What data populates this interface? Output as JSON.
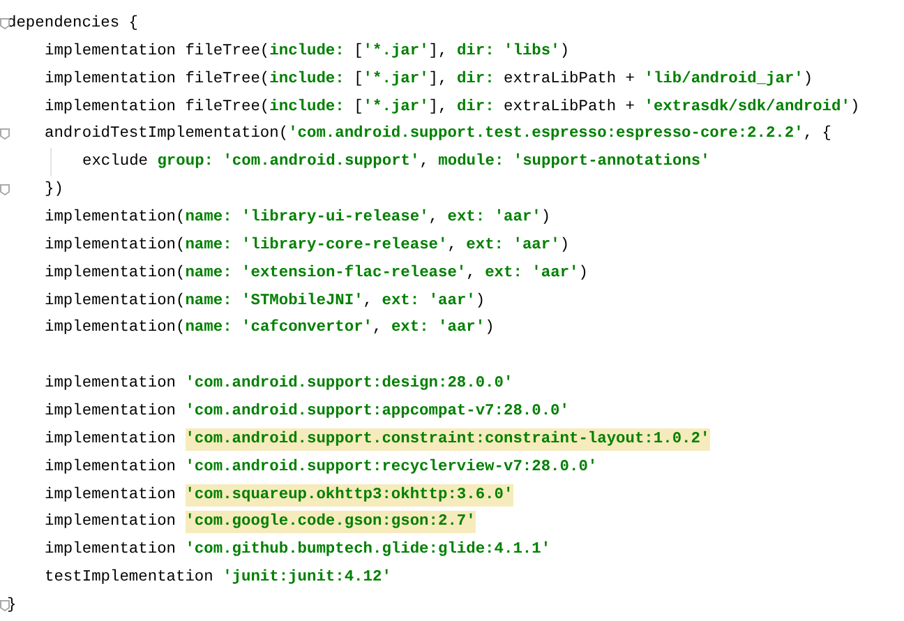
{
  "lines": [
    {
      "kind": "code",
      "fold": true,
      "segments": [
        {
          "kind": "plain",
          "text": "dependencies {"
        }
      ],
      "children": [
        {
          "kind": "code",
          "fold": false,
          "segments": [
            {
              "kind": "plain",
              "text": "implementation fileTree("
            },
            {
              "kind": "param",
              "text": "include: "
            },
            {
              "kind": "plain",
              "text": "["
            },
            {
              "kind": "string",
              "text": "'*.jar'"
            },
            {
              "kind": "plain",
              "text": "], "
            },
            {
              "kind": "param",
              "text": "dir: "
            },
            {
              "kind": "string",
              "text": "'libs'"
            },
            {
              "kind": "plain",
              "text": ")"
            }
          ]
        },
        {
          "kind": "code",
          "fold": false,
          "segments": [
            {
              "kind": "plain",
              "text": "implementation fileTree("
            },
            {
              "kind": "param",
              "text": "include: "
            },
            {
              "kind": "plain",
              "text": "["
            },
            {
              "kind": "string",
              "text": "'*.jar'"
            },
            {
              "kind": "plain",
              "text": "], "
            },
            {
              "kind": "param",
              "text": "dir: "
            },
            {
              "kind": "plain",
              "text": "extraLibPath + "
            },
            {
              "kind": "string",
              "text": "'lib/android_jar'"
            },
            {
              "kind": "plain",
              "text": ")"
            }
          ]
        },
        {
          "kind": "code",
          "fold": false,
          "segments": [
            {
              "kind": "plain",
              "text": "implementation fileTree("
            },
            {
              "kind": "param",
              "text": "include: "
            },
            {
              "kind": "plain",
              "text": "["
            },
            {
              "kind": "string",
              "text": "'*.jar'"
            },
            {
              "kind": "plain",
              "text": "], "
            },
            {
              "kind": "param",
              "text": "dir: "
            },
            {
              "kind": "plain",
              "text": "extraLibPath + "
            },
            {
              "kind": "string",
              "text": "'extrasdk/sdk/android'"
            },
            {
              "kind": "plain",
              "text": ")"
            }
          ]
        },
        {
          "kind": "code",
          "fold": true,
          "segments": [
            {
              "kind": "plain",
              "text": "androidTestImplementation("
            },
            {
              "kind": "string",
              "text": "'com.android.support.test.espresso:espresso-core:2.2.2'"
            },
            {
              "kind": "plain",
              "text": ", {"
            }
          ],
          "children": [
            {
              "kind": "code",
              "fold": false,
              "segments": [
                {
                  "kind": "plain",
                  "text": "exclude "
                },
                {
                  "kind": "param",
                  "text": "group: "
                },
                {
                  "kind": "string",
                  "text": "'com.android.support'"
                },
                {
                  "kind": "plain",
                  "text": ", "
                },
                {
                  "kind": "param",
                  "text": "module: "
                },
                {
                  "kind": "string",
                  "text": "'support-annotations'"
                }
              ]
            }
          ]
        },
        {
          "kind": "code",
          "fold": true,
          "segments": [
            {
              "kind": "plain",
              "text": "})"
            }
          ]
        },
        {
          "kind": "code",
          "fold": false,
          "segments": [
            {
              "kind": "plain",
              "text": "implementation("
            },
            {
              "kind": "param",
              "text": "name: "
            },
            {
              "kind": "string",
              "text": "'library-ui-release'"
            },
            {
              "kind": "plain",
              "text": ", "
            },
            {
              "kind": "param",
              "text": "ext: "
            },
            {
              "kind": "string",
              "text": "'aar'"
            },
            {
              "kind": "plain",
              "text": ")"
            }
          ]
        },
        {
          "kind": "code",
          "fold": false,
          "segments": [
            {
              "kind": "plain",
              "text": "implementation("
            },
            {
              "kind": "param",
              "text": "name: "
            },
            {
              "kind": "string",
              "text": "'library-core-release'"
            },
            {
              "kind": "plain",
              "text": ", "
            },
            {
              "kind": "param",
              "text": "ext: "
            },
            {
              "kind": "string",
              "text": "'aar'"
            },
            {
              "kind": "plain",
              "text": ")"
            }
          ]
        },
        {
          "kind": "code",
          "fold": false,
          "segments": [
            {
              "kind": "plain",
              "text": "implementation("
            },
            {
              "kind": "param",
              "text": "name: "
            },
            {
              "kind": "string",
              "text": "'extension-flac-release'"
            },
            {
              "kind": "plain",
              "text": ", "
            },
            {
              "kind": "param",
              "text": "ext: "
            },
            {
              "kind": "string",
              "text": "'aar'"
            },
            {
              "kind": "plain",
              "text": ")"
            }
          ]
        },
        {
          "kind": "code",
          "fold": false,
          "segments": [
            {
              "kind": "plain",
              "text": "implementation("
            },
            {
              "kind": "param",
              "text": "name: "
            },
            {
              "kind": "string",
              "text": "'STMobileJNI'"
            },
            {
              "kind": "plain",
              "text": ", "
            },
            {
              "kind": "param",
              "text": "ext: "
            },
            {
              "kind": "string",
              "text": "'aar'"
            },
            {
              "kind": "plain",
              "text": ")"
            }
          ]
        },
        {
          "kind": "code",
          "fold": false,
          "segments": [
            {
              "kind": "plain",
              "text": "implementation("
            },
            {
              "kind": "param",
              "text": "name: "
            },
            {
              "kind": "string",
              "text": "'cafconvertor'"
            },
            {
              "kind": "plain",
              "text": ", "
            },
            {
              "kind": "param",
              "text": "ext: "
            },
            {
              "kind": "string",
              "text": "'aar'"
            },
            {
              "kind": "plain",
              "text": ")"
            }
          ]
        },
        {
          "kind": "blank"
        },
        {
          "kind": "code",
          "fold": false,
          "segments": [
            {
              "kind": "plain",
              "text": "implementation "
            },
            {
              "kind": "string",
              "text": "'com.android.support:design:28.0.0'"
            }
          ]
        },
        {
          "kind": "code",
          "fold": false,
          "segments": [
            {
              "kind": "plain",
              "text": "implementation "
            },
            {
              "kind": "string",
              "text": "'com.android.support:appcompat-v7:28.0.0'"
            }
          ]
        },
        {
          "kind": "code",
          "fold": false,
          "segments": [
            {
              "kind": "plain",
              "text": "implementation "
            },
            {
              "kind": "highlight",
              "text": "'com.android.support.constraint:constraint-layout:1.0.2'"
            }
          ]
        },
        {
          "kind": "code",
          "fold": false,
          "segments": [
            {
              "kind": "plain",
              "text": "implementation "
            },
            {
              "kind": "string",
              "text": "'com.android.support:recyclerview-v7:28.0.0'"
            }
          ]
        },
        {
          "kind": "code",
          "fold": false,
          "segments": [
            {
              "kind": "plain",
              "text": "implementation "
            },
            {
              "kind": "highlight",
              "text": "'com.squareup.okhttp3:okhttp:3.6.0'"
            }
          ]
        },
        {
          "kind": "code",
          "fold": false,
          "segments": [
            {
              "kind": "plain",
              "text": "implementation "
            },
            {
              "kind": "highlight",
              "text": "'com.google.code.gson:gson:2.7'"
            }
          ]
        },
        {
          "kind": "code",
          "fold": false,
          "segments": [
            {
              "kind": "plain",
              "text": "implementation "
            },
            {
              "kind": "string",
              "text": "'com.github.bumptech.glide:glide:4.1.1'"
            }
          ]
        },
        {
          "kind": "code",
          "fold": false,
          "segments": [
            {
              "kind": "plain",
              "text": "testImplementation "
            },
            {
              "kind": "string",
              "text": "'junit:junit:4.12'"
            }
          ]
        }
      ]
    },
    {
      "kind": "code",
      "fold": true,
      "segments": [
        {
          "kind": "plain",
          "text": "}"
        }
      ]
    }
  ]
}
